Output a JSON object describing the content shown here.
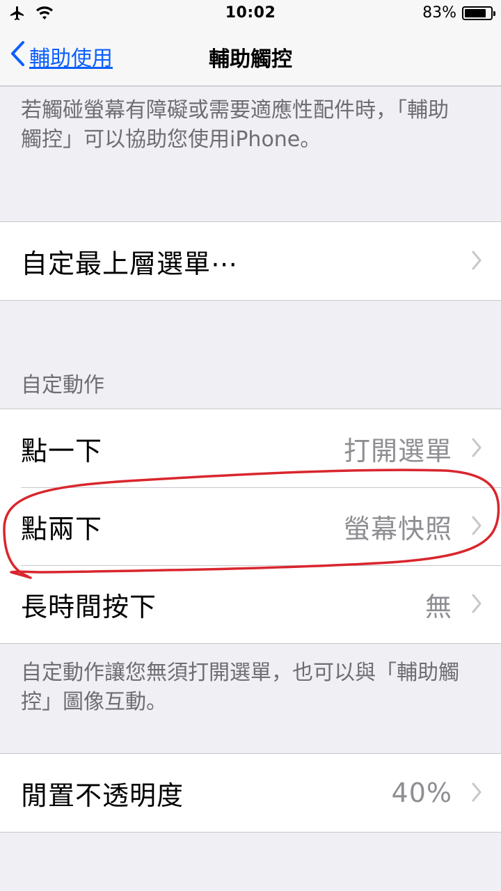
{
  "status_bar": {
    "time": "10:02",
    "battery_text": "83%",
    "battery_level": 0.83
  },
  "nav": {
    "back_label": "輔助使用",
    "title": "輔助觸控"
  },
  "intro": {
    "text": "若觸碰螢幕有障礙或需要適應性配件時，「輔助觸控」可以協助您使用iPhone。"
  },
  "top_menu": {
    "label": "自定最上層選單⋯"
  },
  "custom_actions": {
    "header": "自定動作",
    "rows": [
      {
        "label": "點一下",
        "value": "打開選單"
      },
      {
        "label": "點兩下",
        "value": "螢幕快照"
      },
      {
        "label": "長時間按下",
        "value": "無"
      }
    ],
    "footer": "自定動作讓您無須打開選單，也可以與「輔助觸控」圖像互動。"
  },
  "idle_opacity": {
    "label": "閒置不透明度",
    "value": "40%"
  },
  "colors": {
    "accent": "#0b5fff",
    "annotation": "#d9262d"
  }
}
